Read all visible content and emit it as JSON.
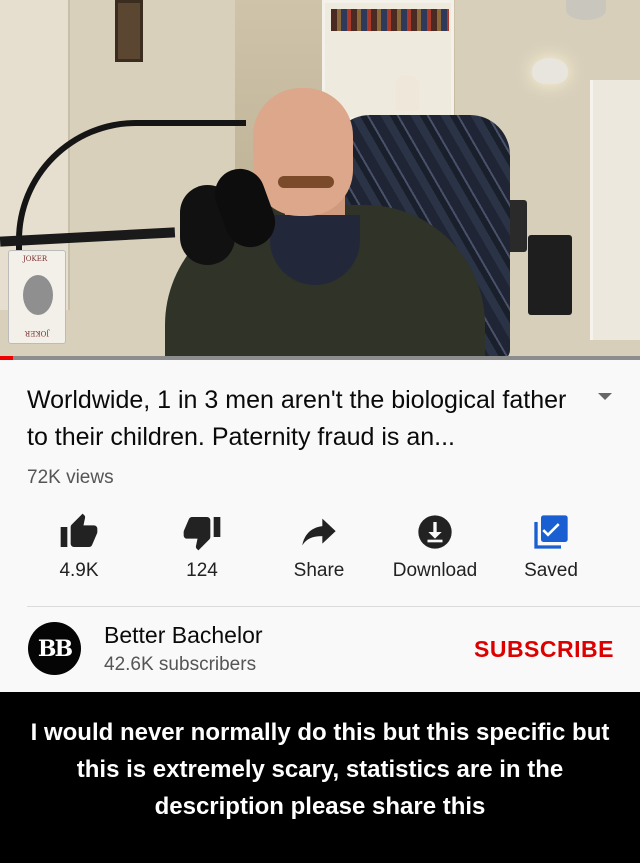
{
  "video": {
    "progress_fraction": 0.02,
    "card_text_top": "JOKER",
    "card_text_bottom": "JOKER"
  },
  "title": "Worldwide, 1 in 3 men aren't the biological father to their children. Paternity fraud is an...",
  "views": "72K views",
  "actions": [
    {
      "icon": "thumbs-up-icon",
      "label": "4.9K"
    },
    {
      "icon": "thumbs-down-icon",
      "label": "124"
    },
    {
      "icon": "share-icon",
      "label": "Share"
    },
    {
      "icon": "download-icon",
      "label": "Download"
    },
    {
      "icon": "saved-icon",
      "label": "Saved"
    }
  ],
  "channel": {
    "avatar_text": "BB",
    "name": "Better Bachelor",
    "subscribers": "42.6K subscribers",
    "subscribe_label": "SUBSCRIBE"
  },
  "caption": "I would never normally do this but this specific but this is extremely scary, statistics are in the description please share this",
  "colors": {
    "accent_red": "#dd0000",
    "saved_blue": "#1a5fd1",
    "icon_dark": "#222222"
  }
}
